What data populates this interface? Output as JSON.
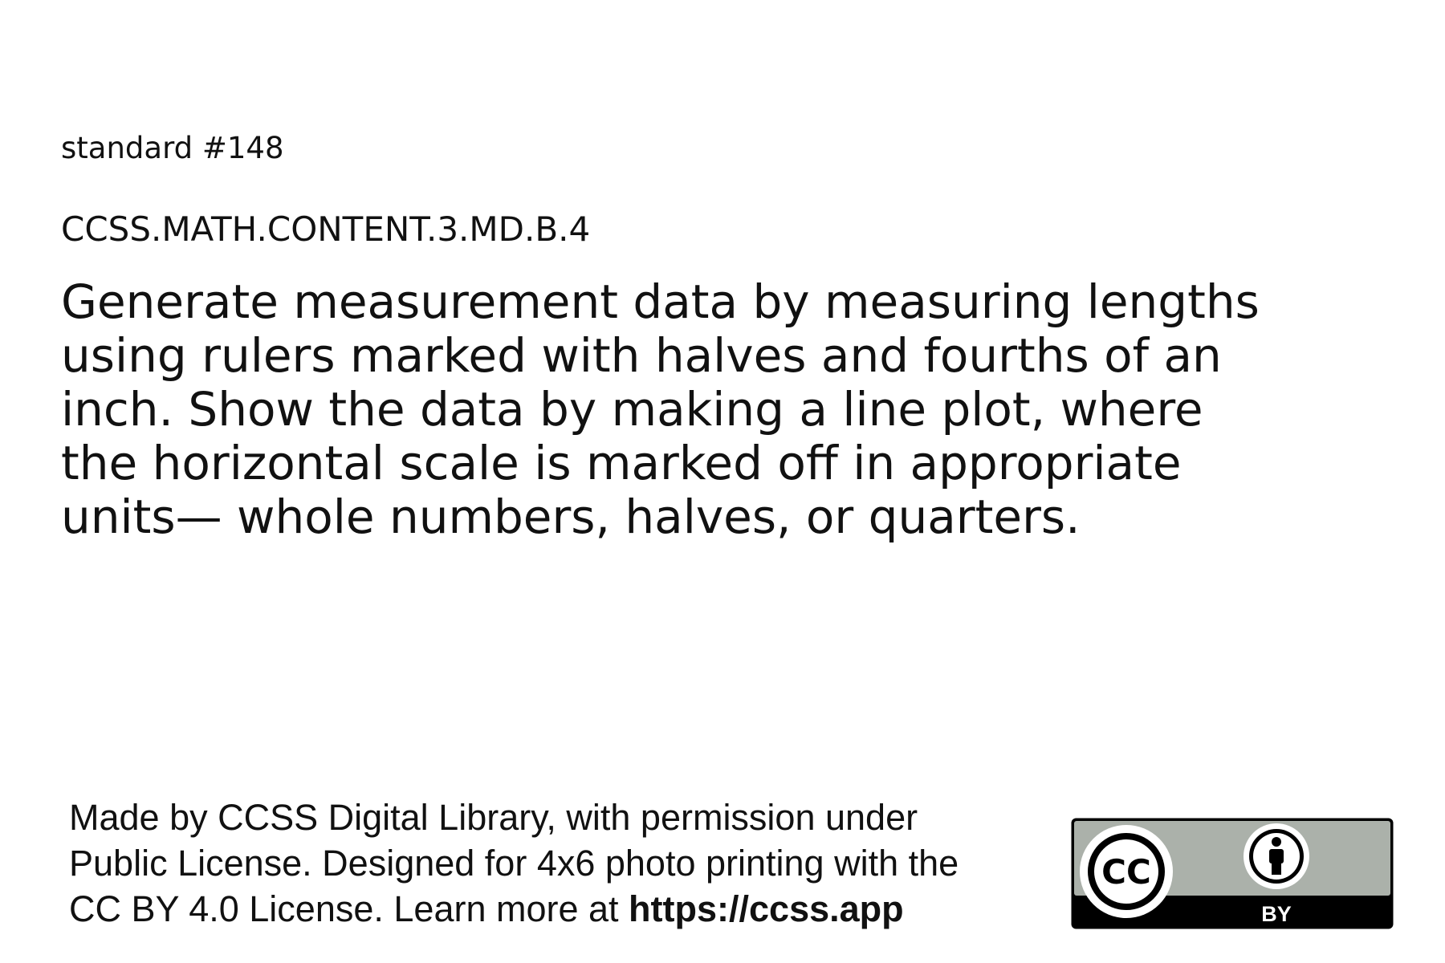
{
  "header": {
    "standard_number": "standard #148",
    "standard_code": "CCSS.MATH.CONTENT.3.MD.B.4"
  },
  "main": {
    "standard_text": "Generate measurement data by measuring lengths\nusing rulers marked with halves and fourths of an\ninch. Show the data by making a line plot, where\nthe horizontal scale is marked off in appropriate\nunits— whole numbers, halves, or quarters."
  },
  "footer": {
    "attribution_text": "Made by CCSS Digital Library, with permission under\nPublic License. Designed for 4x6 photo printing with the\nCC BY 4.0 License. Learn more at ",
    "attribution_url": "https://ccss.app",
    "license_badge": {
      "cc_label": "CC",
      "by_label": "BY",
      "icon_cc": "creative-commons-icon",
      "icon_by": "attribution-person-icon",
      "colors": {
        "badge_gray": "#abb1aa",
        "badge_black": "#000000"
      }
    }
  }
}
